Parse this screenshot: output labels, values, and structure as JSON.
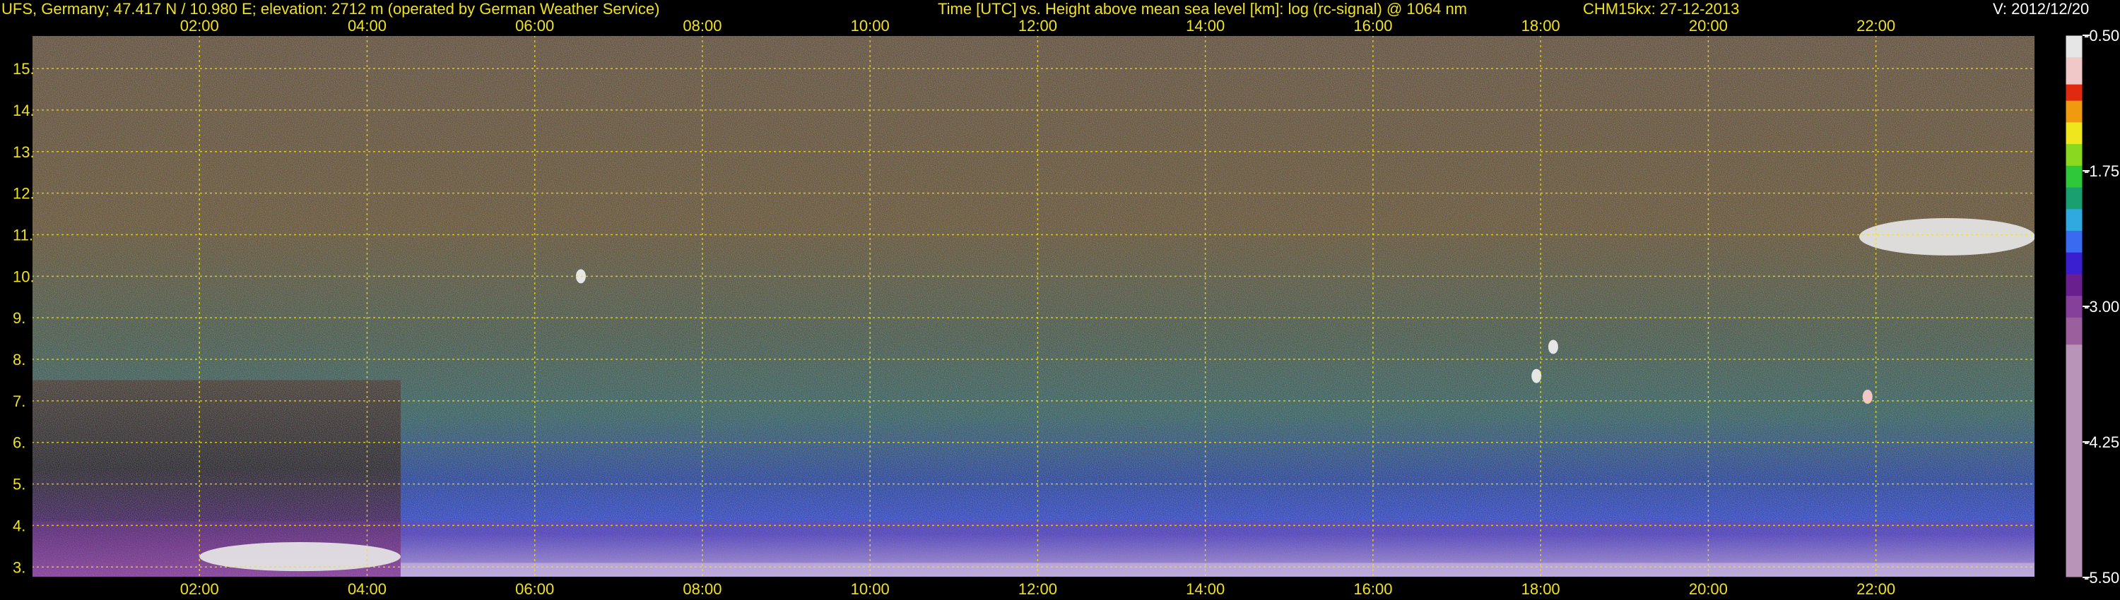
{
  "header": {
    "station": "UFS, Germany; 47.417 N / 10.980 E; elevation: 2712 m  (operated by German Weather Service)",
    "plot_title": "Time [UTC] vs. Height above mean sea level [km]: log (rc-signal) @ 1064 nm",
    "instrument_date": "CHM15kx: 27-12-2013",
    "version": "V: 2012/12/20"
  },
  "colors": {
    "background": "#000000",
    "text": "#f0e11e",
    "grid": "#f0e11e",
    "colorbar_ticks": "#ffffff"
  },
  "chart_data": {
    "type": "heatmap",
    "xlabel": "Time [UTC]",
    "ylabel": "Height above mean sea level [km]",
    "x_unit": "hours UTC",
    "xlim": [
      0.0,
      23.9
    ],
    "ylim": [
      2.75,
      15.8
    ],
    "x_ticks": [
      {
        "value": 2,
        "label": "02:00"
      },
      {
        "value": 4,
        "label": "04:00"
      },
      {
        "value": 6,
        "label": "06:00"
      },
      {
        "value": 8,
        "label": "08:00"
      },
      {
        "value": 10,
        "label": "10:00"
      },
      {
        "value": 12,
        "label": "12:00"
      },
      {
        "value": 14,
        "label": "14:00"
      },
      {
        "value": 16,
        "label": "16:00"
      },
      {
        "value": 18,
        "label": "18:00"
      },
      {
        "value": 20,
        "label": "20:00"
      },
      {
        "value": 22,
        "label": "22:00"
      }
    ],
    "y_ticks": [
      {
        "value": 3,
        "label": "3."
      },
      {
        "value": 4,
        "label": "4."
      },
      {
        "value": 5,
        "label": "5."
      },
      {
        "value": 6,
        "label": "6."
      },
      {
        "value": 7,
        "label": "7."
      },
      {
        "value": 8,
        "label": "8."
      },
      {
        "value": 9,
        "label": "9."
      },
      {
        "value": 10,
        "label": "10."
      },
      {
        "value": 11,
        "label": "11."
      },
      {
        "value": 12,
        "label": "12."
      },
      {
        "value": 13,
        "label": "13."
      },
      {
        "value": 14,
        "label": "14."
      },
      {
        "value": 15,
        "label": "15."
      }
    ],
    "grid": true,
    "colorbar": {
      "range": [
        -5.5,
        -0.5
      ],
      "ticks": [
        {
          "value": -0.5,
          "label": "-0.50"
        },
        {
          "value": -1.75,
          "label": "-1.75"
        },
        {
          "value": -3.0,
          "label": "-3.00"
        },
        {
          "value": -4.25,
          "label": "-4.25"
        },
        {
          "value": -5.5,
          "label": "-5.50"
        }
      ],
      "stops": [
        {
          "value": -5.5,
          "color": "#b894b8"
        },
        {
          "value": -3.6,
          "color": "#b894b8"
        },
        {
          "value": -3.35,
          "color": "#9a5f9c"
        },
        {
          "value": -3.1,
          "color": "#84409a"
        },
        {
          "value": -2.9,
          "color": "#6a1f8e"
        },
        {
          "value": -2.7,
          "color": "#3a1fd0"
        },
        {
          "value": -2.5,
          "color": "#3a6af0"
        },
        {
          "value": -2.3,
          "color": "#30a8e0"
        },
        {
          "value": -2.1,
          "color": "#1aa070"
        },
        {
          "value": -1.9,
          "color": "#2ec83a"
        },
        {
          "value": -1.7,
          "color": "#8ad820"
        },
        {
          "value": -1.5,
          "color": "#f0e61e"
        },
        {
          "value": -1.3,
          "color": "#f09a10"
        },
        {
          "value": -1.1,
          "color": "#e02a10"
        },
        {
          "value": -0.95,
          "color": "#f0c8c8"
        },
        {
          "value": -0.7,
          "color": "#e6e6e6"
        },
        {
          "value": -0.5,
          "color": "#ffffff"
        }
      ]
    },
    "features": [
      {
        "name": "boundary-layer",
        "x_range": [
          0,
          23.9
        ],
        "y_range": [
          2.75,
          4.1
        ],
        "level": -3.0
      },
      {
        "name": "cloud",
        "x": 6.55,
        "y": 10.0,
        "level": -0.6
      },
      {
        "name": "cloud",
        "x": 18.15,
        "y": 8.3,
        "level": -0.7
      },
      {
        "name": "cloud",
        "x": 17.95,
        "y": 7.6,
        "level": -0.7
      },
      {
        "name": "cloud",
        "x": 21.9,
        "y": 7.1,
        "level": -0.8
      },
      {
        "name": "cloud",
        "x_range": [
          21.8,
          23.9
        ],
        "y_range": [
          10.5,
          11.4
        ],
        "level": -0.6
      },
      {
        "name": "low-cloud",
        "x_range": [
          2.0,
          4.4
        ],
        "y_range": [
          2.9,
          3.6
        ],
        "level": -0.6
      }
    ]
  }
}
